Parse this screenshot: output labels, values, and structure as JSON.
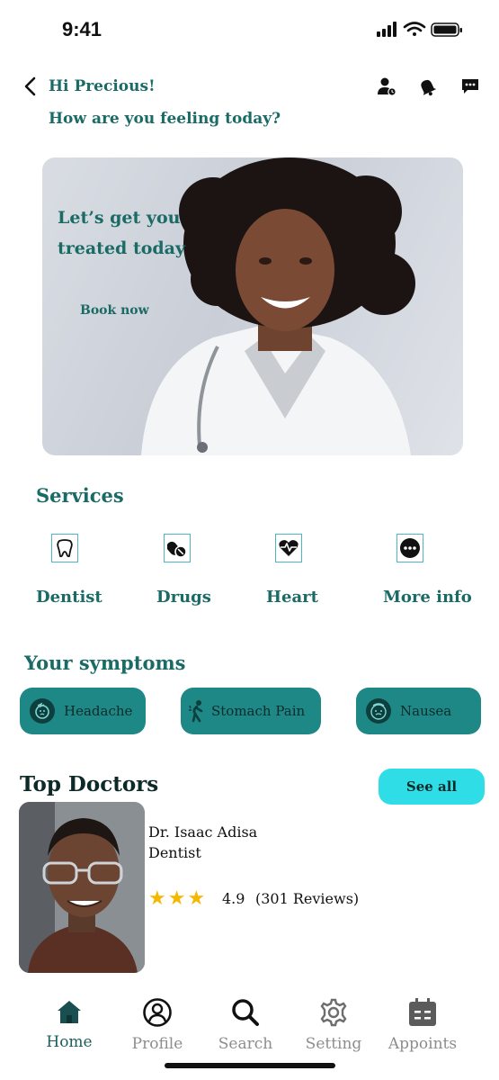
{
  "status_bar": {
    "time": "9:41"
  },
  "header": {
    "greeting": "Hi Precious!",
    "question": "How are you feeling today?",
    "icons": [
      "person-clock-icon",
      "bell-icon",
      "chat-icon"
    ]
  },
  "hero": {
    "text": "Let’s get you treated today",
    "button": "Book now"
  },
  "services": {
    "title": "Services",
    "items": [
      {
        "label": "Dentist",
        "icon": "tooth-icon"
      },
      {
        "label": "Drugs",
        "icon": "pills-icon"
      },
      {
        "label": "Heart",
        "icon": "heart-pulse-icon"
      },
      {
        "label": "More info",
        "icon": "more-icon"
      }
    ]
  },
  "symptoms": {
    "title": "Your symptoms",
    "items": [
      {
        "label": "Headache",
        "icon": "headache-icon"
      },
      {
        "label": "Stomach Pain",
        "icon": "stomach-pain-icon"
      },
      {
        "label": "Nausea",
        "icon": "nausea-icon"
      }
    ]
  },
  "top_doctors": {
    "title": "Top Doctors",
    "see_all": "See all",
    "doctor": {
      "name": "Dr. Isaac Adisa",
      "specialty": "Dentist",
      "stars": "★★★",
      "rating": "4.9",
      "reviews": "(301 Reviews)"
    }
  },
  "nav": {
    "items": [
      {
        "label": "Home",
        "icon": "home-icon"
      },
      {
        "label": "Profile",
        "icon": "profile-icon"
      },
      {
        "label": "Search",
        "icon": "search-icon"
      },
      {
        "label": "Setting",
        "icon": "gear-icon"
      },
      {
        "label": "Appoints",
        "icon": "calendar-icon"
      }
    ],
    "active_color": "#1a5f5c",
    "inactive_color": "#8d8d8d"
  },
  "colors": {
    "primary": "#1a6a66",
    "chip": "#1e8886",
    "see_all": "#2fdde6",
    "star": "#f5b800"
  }
}
